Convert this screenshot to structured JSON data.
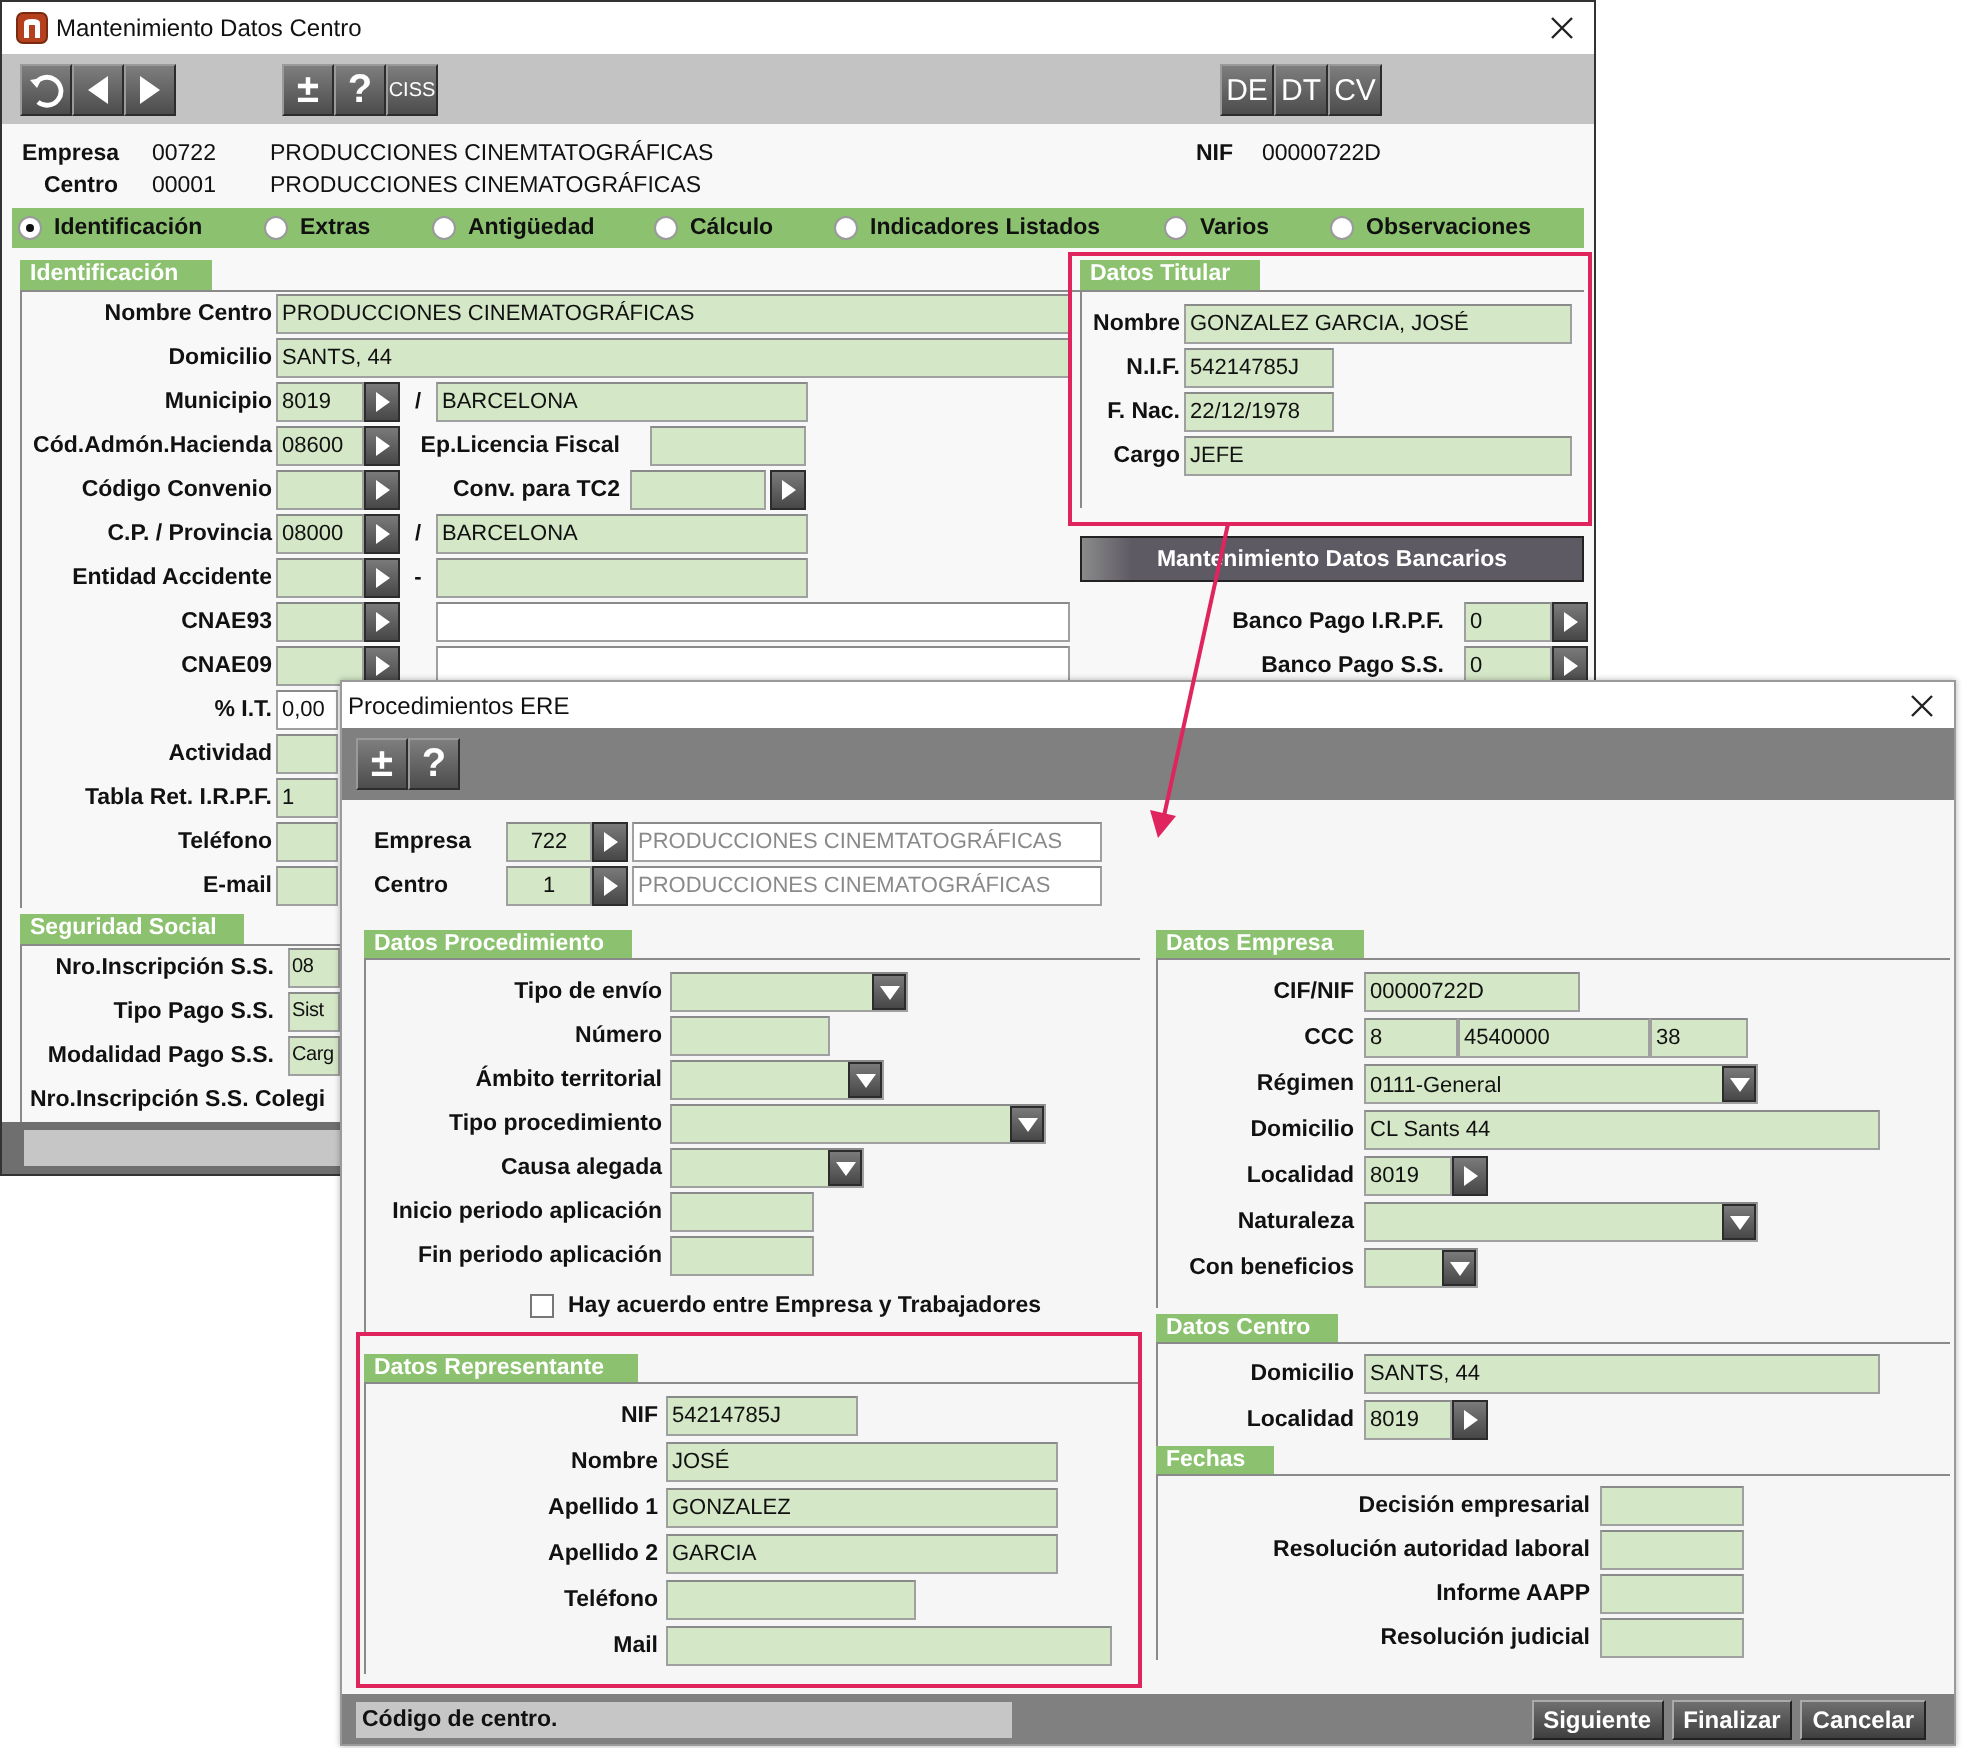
{
  "main_window": {
    "title": "Mantenimiento Datos Centro",
    "toolbar": {
      "nav": [
        {
          "kind": "refresh"
        },
        {
          "kind": "back"
        },
        {
          "kind": "forward"
        }
      ],
      "tools": [
        "±",
        "?",
        "CISS"
      ],
      "codes": [
        "DE",
        "DT",
        "CV"
      ]
    },
    "header": {
      "empresa": {
        "label": "Empresa",
        "code": "00722",
        "name": "PRODUCCIONES CINEMTATOGRÁFICAS"
      },
      "centro": {
        "label": "Centro",
        "code": "00001",
        "name": "PRODUCCIONES CINEMATOGRÁFICAS"
      },
      "nif": {
        "label": "NIF",
        "value": "00000722D"
      }
    },
    "tabs": [
      {
        "label": "Identificación",
        "selected": true
      },
      {
        "label": "Extras",
        "selected": false
      },
      {
        "label": "Antigüedad",
        "selected": false
      },
      {
        "label": "Cálculo",
        "selected": false
      },
      {
        "label": "Indicadores Listados",
        "selected": false
      },
      {
        "label": "Varios",
        "selected": false
      },
      {
        "label": "Observaciones",
        "selected": false
      }
    ],
    "identificacion": {
      "title": "Identificación",
      "rows": [
        {
          "kind": "wide",
          "label": "Nombre Centro",
          "value": "PRODUCCIONES CINEMATOGRÁFICAS"
        },
        {
          "kind": "wide",
          "label": "Domicilio",
          "value": "SANTS, 44"
        },
        {
          "kind": "pair",
          "label": "Municipio",
          "code": "8019",
          "sep": "/",
          "value": "BARCELONA"
        },
        {
          "kind": "labeled",
          "label": "Cód.Admón.Hacienda",
          "code": "08600",
          "extra_label": "Ep.Licencia Fiscal"
        },
        {
          "kind": "pick",
          "label": "Código Convenio",
          "extra_label": "Conv. para TC2"
        },
        {
          "kind": "pair",
          "label": "C.P. / Provincia",
          "code": "08000",
          "sep": "/",
          "value": "BARCELONA"
        },
        {
          "kind": "pair",
          "label": "Entidad Accidente",
          "sep": "-"
        },
        {
          "kind": "open",
          "label": "CNAE93"
        },
        {
          "kind": "open",
          "label": "CNAE09"
        },
        {
          "kind": "short-white",
          "label": "% I.T.",
          "value": "0,00"
        },
        {
          "kind": "short",
          "label": "Actividad"
        },
        {
          "kind": "short",
          "label": "Tabla Ret. I.R.P.F.",
          "value": "1"
        },
        {
          "kind": "short",
          "label": "Teléfono"
        },
        {
          "kind": "short",
          "label": "E-mail"
        }
      ]
    },
    "seguridad_social": {
      "title": "Seguridad Social",
      "rows": [
        {
          "label": "Nro.Inscripción S.S.",
          "value": "08"
        },
        {
          "label": "Tipo Pago S.S.",
          "value": "Sist"
        },
        {
          "label": "Modalidad Pago S.S.",
          "value": "Carg"
        },
        {
          "label": "Nro.Inscripción S.S. Colegi"
        }
      ]
    },
    "titular": {
      "title": "Datos Titular",
      "rows": [
        {
          "label": "Nombre",
          "value": "GONZALEZ GARCIA, JOSÉ"
        },
        {
          "label": "N.I.F.",
          "value": "54214785J"
        },
        {
          "label": "F. Nac.",
          "value": "22/12/1978"
        },
        {
          "label": "Cargo",
          "value": "JEFE"
        }
      ]
    },
    "bank_button": "Mantenimiento Datos Bancarios",
    "bancos": [
      {
        "label": "Banco Pago I.R.P.F.",
        "value": "0"
      },
      {
        "label": "Banco Pago S.S.",
        "value": "0"
      }
    ]
  },
  "dialog": {
    "title": "Procedimientos ERE",
    "toolbar": [
      "±",
      "?"
    ],
    "empresa": {
      "label": "Empresa",
      "code": "722",
      "name": "PRODUCCIONES CINEMTATOGRÁFICAS"
    },
    "centro": {
      "label": "Centro",
      "code": "1",
      "name": "PRODUCCIONES CINEMATOGRÁFICAS"
    },
    "procedimiento": {
      "title": "Datos Procedimiento",
      "rows": [
        {
          "kind": "combo",
          "label": "Tipo de envío"
        },
        {
          "kind": "text",
          "label": "Número"
        },
        {
          "kind": "combo",
          "label": "Ámbito territorial"
        },
        {
          "kind": "combo",
          "label": "Tipo procedimiento"
        },
        {
          "kind": "combo",
          "label": "Causa alegada"
        },
        {
          "kind": "text",
          "label": "Inicio periodo aplicación"
        },
        {
          "kind": "text",
          "label": "Fin periodo aplicación"
        }
      ]
    },
    "agreement": {
      "label": "Hay acuerdo entre Empresa y Trabajadores",
      "checked": false
    },
    "representante": {
      "title": "Datos Representante",
      "rows": [
        {
          "label": "NIF",
          "value": "54214785J"
        },
        {
          "label": "Nombre",
          "value": "JOSÉ"
        },
        {
          "label": "Apellido 1",
          "value": "GONZALEZ"
        },
        {
          "label": "Apellido 2",
          "value": "GARCIA"
        },
        {
          "label": "Teléfono"
        },
        {
          "label": "Mail"
        }
      ]
    },
    "empresa_data": {
      "title": "Datos Empresa",
      "rows": [
        {
          "kind": "text",
          "label": "CIF/NIF",
          "value": "00000722D"
        },
        {
          "kind": "ccc",
          "label": "CCC",
          "parts": [
            "8",
            "4540000",
            "38"
          ]
        },
        {
          "kind": "combo",
          "label": "Régimen",
          "value": "0111-General"
        },
        {
          "kind": "text",
          "label": "Domicilio",
          "value": "CL Sants 44"
        },
        {
          "kind": "lookup",
          "label": "Localidad",
          "value": "8019"
        },
        {
          "kind": "combo",
          "label": "Naturaleza"
        },
        {
          "kind": "combo",
          "label": "Con beneficios"
        }
      ]
    },
    "centro_data": {
      "title": "Datos Centro",
      "rows": [
        {
          "kind": "text",
          "label": "Domicilio",
          "value": "SANTS, 44"
        },
        {
          "kind": "lookup",
          "label": "Localidad",
          "value": "8019"
        }
      ]
    },
    "fechas": {
      "title": "Fechas",
      "rows": [
        {
          "label": "Decisión empresarial"
        },
        {
          "label": "Resolución autoridad laboral"
        },
        {
          "label": "Informe AAPP"
        },
        {
          "label": "Resolución judicial"
        }
      ]
    },
    "status": "Código de centro.",
    "buttons": [
      "Siguiente",
      "Finalizar",
      "Cancelar"
    ]
  }
}
